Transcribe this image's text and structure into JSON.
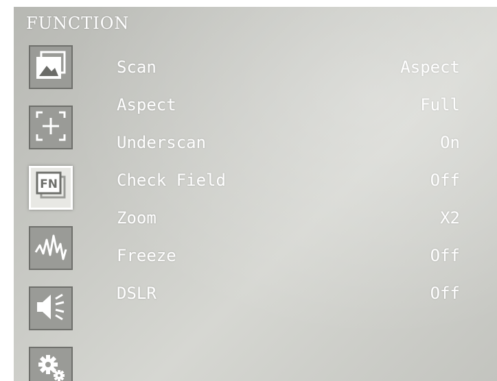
{
  "menu_title": "FUNCTION",
  "sidebar": {
    "icons": [
      {
        "name": "picture-icon"
      },
      {
        "name": "marker-icon"
      },
      {
        "name": "fn-icon",
        "selected": true
      },
      {
        "name": "waveform-icon"
      },
      {
        "name": "speaker-icon"
      },
      {
        "name": "gear-icon"
      }
    ]
  },
  "settings": [
    {
      "label": "Scan",
      "value": "Aspect"
    },
    {
      "label": "Aspect",
      "value": "Full"
    },
    {
      "label": "Underscan",
      "value": "On"
    },
    {
      "label": "Check Field",
      "value": "Off"
    },
    {
      "label": "Zoom",
      "value": "X2"
    },
    {
      "label": "Freeze",
      "value": "Off"
    },
    {
      "label": "DSLR",
      "value": "Off"
    }
  ],
  "colors": {
    "text": "#ffffff",
    "background": "#c9cac5",
    "icon_bg": "#9a9b97",
    "selected_bg": "#e8e8e4"
  }
}
